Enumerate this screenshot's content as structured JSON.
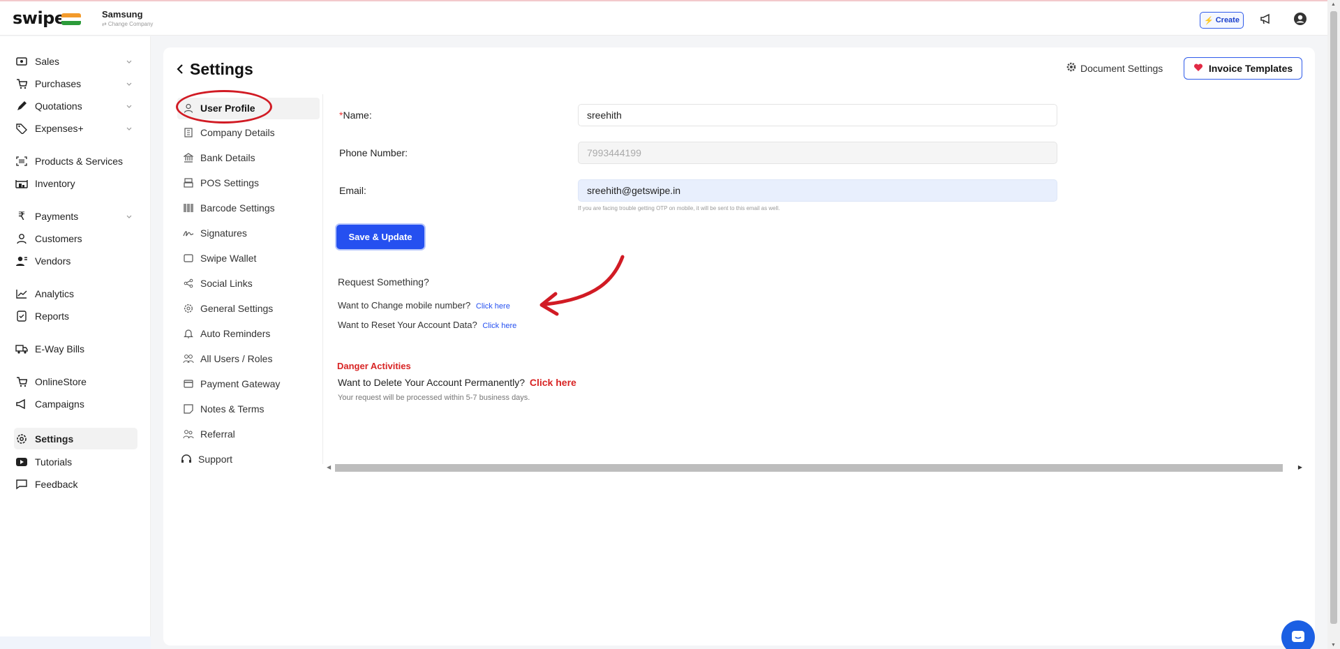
{
  "app": {
    "logo": "swipe",
    "company_name": "Samsung",
    "change_company": "⇄ Change Company",
    "create_label": "Create",
    "brand_color": "#2550f0",
    "danger_color": "#d82424"
  },
  "sidebar": {
    "items": [
      {
        "label": "Sales",
        "icon": "cash-icon",
        "expandable": true
      },
      {
        "label": "Purchases",
        "icon": "cart-icon",
        "expandable": true
      },
      {
        "label": "Quotations",
        "icon": "pen-icon",
        "expandable": true
      },
      {
        "label": "Expenses+",
        "icon": "tag-icon",
        "expandable": true
      },
      {
        "label": "Products & Services",
        "icon": "barcode-scan-icon"
      },
      {
        "label": "Inventory",
        "icon": "warehouse-icon"
      },
      {
        "label": "Payments",
        "icon": "rupee-icon",
        "expandable": true
      },
      {
        "label": "Customers",
        "icon": "user-icon"
      },
      {
        "label": "Vendors",
        "icon": "vendor-icon"
      },
      {
        "label": "Analytics",
        "icon": "chart-icon"
      },
      {
        "label": "Reports",
        "icon": "report-icon"
      },
      {
        "label": "E-Way Bills",
        "icon": "truck-icon"
      },
      {
        "label": "OnlineStore",
        "icon": "store-icon"
      },
      {
        "label": "Campaigns",
        "icon": "megaphone-icon"
      },
      {
        "label": "Settings",
        "icon": "gear-icon",
        "active": true
      },
      {
        "label": "Tutorials",
        "icon": "youtube-icon"
      },
      {
        "label": "Feedback",
        "icon": "message-icon"
      }
    ]
  },
  "page": {
    "title": "Settings",
    "document_settings": "Document Settings",
    "invoice_templates": "Invoice Templates"
  },
  "submenu": {
    "items": [
      {
        "label": "User Profile",
        "icon": "user-icon",
        "active": true
      },
      {
        "label": "Company Details",
        "icon": "building-icon"
      },
      {
        "label": "Bank Details",
        "icon": "bank-icon"
      },
      {
        "label": "POS Settings",
        "icon": "pos-icon"
      },
      {
        "label": "Barcode Settings",
        "icon": "barcode-icon"
      },
      {
        "label": "Signatures",
        "icon": "signature-icon"
      },
      {
        "label": "Swipe Wallet",
        "icon": "wallet-icon"
      },
      {
        "label": "Social Links",
        "icon": "share-icon"
      },
      {
        "label": "General Settings",
        "icon": "gear-icon"
      },
      {
        "label": "Auto Reminders",
        "icon": "bell-icon"
      },
      {
        "label": "All Users / Roles",
        "icon": "users-icon"
      },
      {
        "label": "Payment Gateway",
        "icon": "card-icon"
      },
      {
        "label": "Notes & Terms",
        "icon": "note-icon"
      },
      {
        "label": "Referral",
        "icon": "referral-icon"
      },
      {
        "label": "Support",
        "icon": "headset-icon"
      }
    ]
  },
  "form": {
    "name_label": "Name",
    "name_value": "sreehith",
    "phone_label": "Phone Number",
    "phone_value": "7993444199",
    "email_label": "Email",
    "email_value": "sreehith@getswipe.in",
    "email_hint": "If you are facing trouble getting OTP on mobile, it will be sent to this email as well.",
    "save_label": "Save & Update"
  },
  "requests": {
    "title": "Request Something?",
    "change_mobile": "Want to Change mobile number?",
    "reset_data": "Want to Reset Your Account Data?",
    "link_label": "Click here"
  },
  "danger": {
    "title": "Danger Activities",
    "delete_text": "Want to Delete Your Account Permanently?",
    "link_label": "Click here",
    "note": "Your request will be processed within 5-7 business days."
  }
}
